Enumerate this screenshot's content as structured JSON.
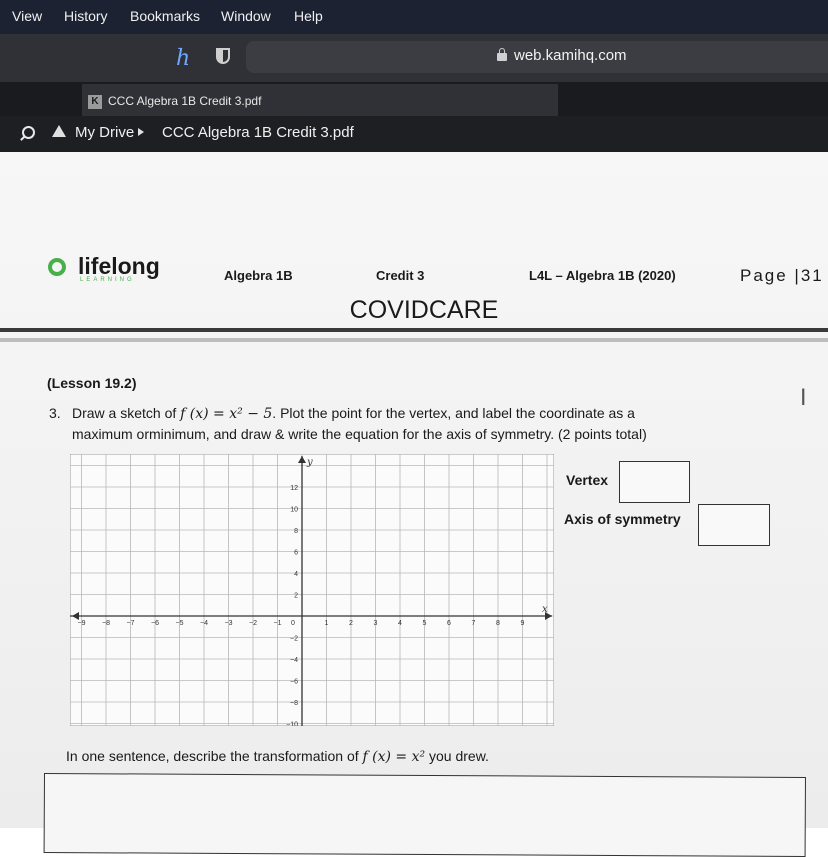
{
  "menubar": {
    "items": [
      "View",
      "History",
      "Bookmarks",
      "Window",
      "Help"
    ]
  },
  "browser": {
    "url": "web.kamihq.com",
    "tab_title": "CCC Algebra 1B Credit 3.pdf",
    "tab_icon": "K"
  },
  "drive": {
    "root": "My Drive",
    "file": "CCC Algebra 1B Credit 3.pdf"
  },
  "doc": {
    "logo_text": "lifelong",
    "logo_sub": "LEARNING",
    "course": "Algebra 1B",
    "credit": "Credit 3",
    "program": "L4L – Algebra 1B (2020)",
    "page": "Page |31",
    "heading": "COVIDCARE",
    "lesson": "(Lesson 19.2)",
    "question_number": "3.",
    "question_line1_pre": "Draw a sketch of ",
    "question_fx": "f (x)  =  x² − 5",
    "question_line1_post": ". Plot the point for the vertex, and label the coordinate as a",
    "question_line2": "maximum orminimum, and draw & write the equation for the axis of symmetry. (2 points total)",
    "vertex_label": "Vertex",
    "axis_label": "Axis of symmetry",
    "describe_pre": "In one sentence, describe the transformation of ",
    "describe_fx": "f (x)  =  x²",
    "describe_post": " you drew."
  },
  "graph": {
    "x_ticks": [
      "−9",
      "−8",
      "−7",
      "−6",
      "−5",
      "−4",
      "−3",
      "−2",
      "−1",
      "0",
      "1",
      "2",
      "3",
      "4",
      "5",
      "6",
      "7",
      "8",
      "9"
    ],
    "y_ticks_pos": [
      "12",
      "10",
      "8",
      "6",
      "4",
      "2"
    ],
    "y_ticks_neg": [
      "−2",
      "−4",
      "−6",
      "−8",
      "−10"
    ],
    "x_axis_label": "x",
    "y_axis_label": "y"
  },
  "colors": {
    "menubar": "#1d2233",
    "logo_green": "#48b04b",
    "page": "#f4f4f4"
  }
}
